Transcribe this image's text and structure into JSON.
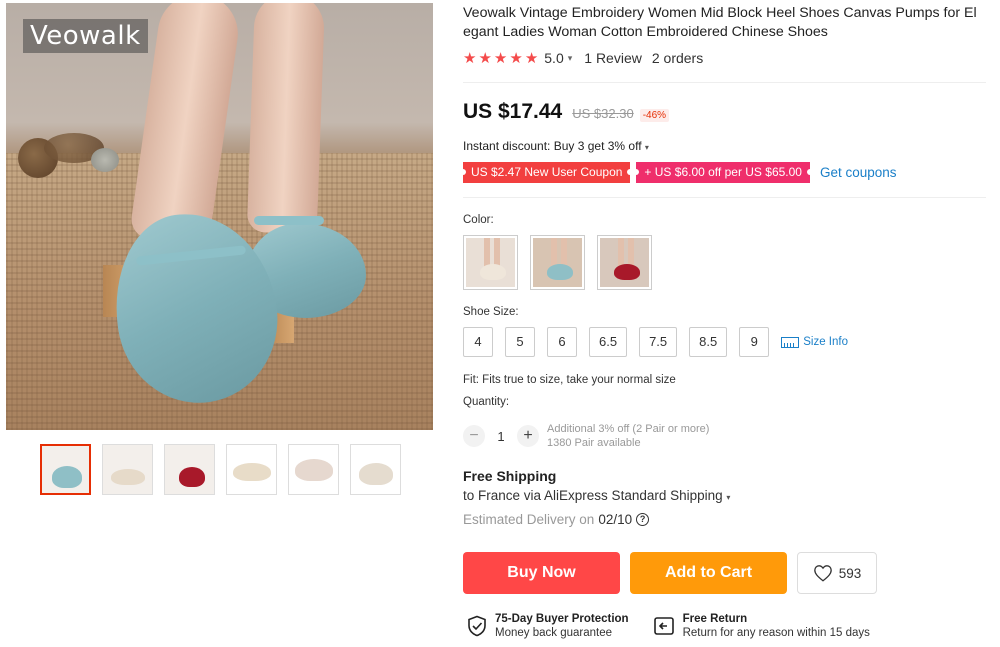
{
  "gallery": {
    "brand_watermark": "Veowalk",
    "thumbnails": [
      "thumb-1",
      "thumb-2",
      "thumb-3",
      "thumb-4",
      "thumb-5",
      "thumb-6"
    ]
  },
  "product": {
    "title": "Veowalk Vintage Embroidery Women Mid Block Heel Shoes Canvas Pumps for Elegant Ladies Woman Cotton Embroidered Chinese Shoes",
    "rating": {
      "stars": 5,
      "score": "5.0",
      "reviews": "1 Review",
      "orders": "2 orders"
    },
    "price": {
      "current": "US $17.44",
      "original": "US $32.30",
      "discount": "-46%"
    },
    "instant_discount": "Instant discount: Buy 3 get 3% off",
    "coupons": {
      "new_user": "US $2.47 New User Coupon",
      "store": "+ US $6.00 off per US $65.00",
      "get_coupons": "Get coupons"
    },
    "color": {
      "label": "Color:",
      "options": [
        {
          "name": "beige",
          "color": "#e8ddd0"
        },
        {
          "name": "blue",
          "color": "#8fbfc6"
        },
        {
          "name": "red",
          "color": "#a8192a"
        }
      ]
    },
    "size": {
      "label": "Shoe Size:",
      "options": [
        "4",
        "5",
        "6",
        "6.5",
        "7.5",
        "8.5",
        "9"
      ],
      "size_info": "Size Info"
    },
    "fit": "Fit: Fits true to size, take your normal size",
    "quantity": {
      "label": "Quantity:",
      "value": "1",
      "minus": "−",
      "plus": "+",
      "note_line1": "Additional 3% off (2 Pair or more)",
      "note_line2": "1380 Pair available"
    },
    "shipping": {
      "title": "Free Shipping",
      "detail": "to France via AliExpress Standard Shipping",
      "delivery_prefix": "Estimated Delivery on",
      "delivery_date": "02/10",
      "help": "?"
    },
    "actions": {
      "buy_now": "Buy Now",
      "add_to_cart": "Add to Cart",
      "wishlist_count": "593"
    },
    "guarantees": [
      {
        "icon": "shield-check-icon",
        "title": "75-Day Buyer Protection",
        "subtitle": "Money back guarantee"
      },
      {
        "icon": "return-icon",
        "title": "Free Return",
        "subtitle": "Return for any reason within 15 days"
      }
    ]
  },
  "colors": {
    "accent_red": "#ff4747",
    "accent_orange": "#ff9a0a",
    "link_blue": "#1a7fc8",
    "star_red": "#f44b4b"
  }
}
